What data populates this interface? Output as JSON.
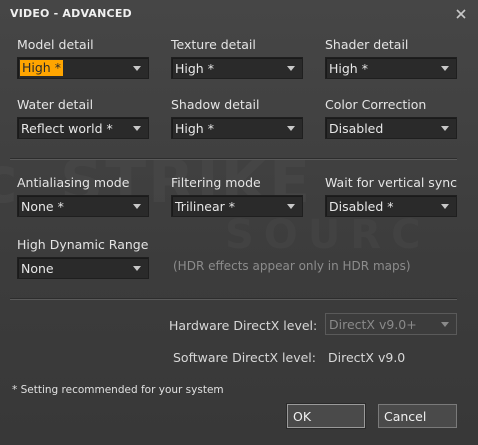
{
  "window": {
    "title": "VIDEO - ADVANCED",
    "close_icon": "close-icon"
  },
  "watermark": {
    "text_top": "STRIKE",
    "text_bottom": "SOURC"
  },
  "settings": {
    "model_detail": {
      "label": "Model detail",
      "value": "High *",
      "highlighted": true
    },
    "texture_detail": {
      "label": "Texture detail",
      "value": "High *"
    },
    "shader_detail": {
      "label": "Shader detail",
      "value": "High *"
    },
    "water_detail": {
      "label": "Water detail",
      "value": "Reflect world *"
    },
    "shadow_detail": {
      "label": "Shadow detail",
      "value": "High *"
    },
    "color_correction": {
      "label": "Color Correction",
      "value": "Disabled"
    },
    "antialiasing": {
      "label": "Antialiasing mode",
      "value": "None *"
    },
    "filtering": {
      "label": "Filtering mode",
      "value": "Trilinear *"
    },
    "vsync": {
      "label": "Wait for vertical sync",
      "value": "Disabled *"
    },
    "hdr": {
      "label": "High Dynamic Range",
      "value": "None",
      "hint": "(HDR effects appear only in HDR maps)"
    }
  },
  "directx": {
    "hardware_label": "Hardware DirectX level:",
    "hardware_value": "DirectX v9.0+",
    "software_label": "Software DirectX level:",
    "software_value": "DirectX v9.0"
  },
  "footer": {
    "note": "* Setting recommended for your system",
    "ok_label": "OK",
    "cancel_label": "Cancel"
  },
  "colors": {
    "highlight": "#ffa500",
    "background": "#3d3d3d"
  }
}
